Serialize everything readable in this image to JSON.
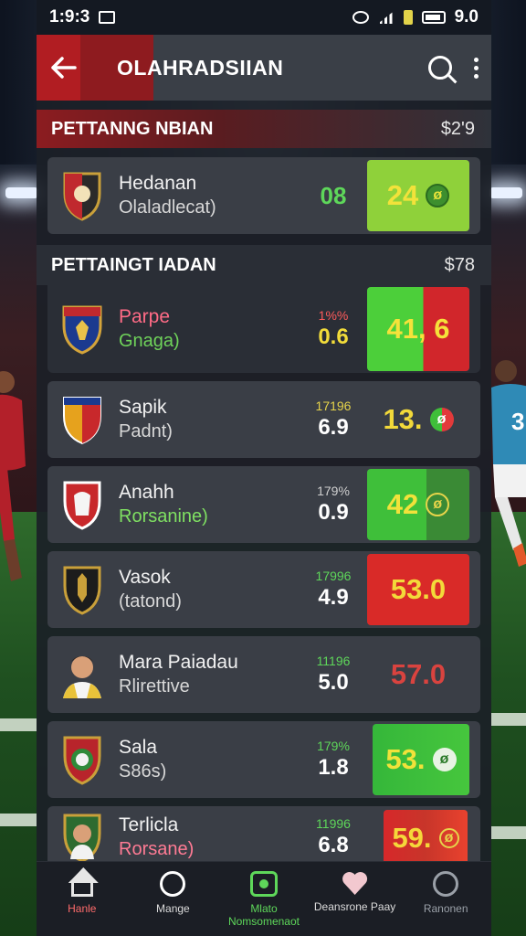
{
  "status": {
    "time": "1:9:3",
    "right_text": "9.0"
  },
  "appbar": {
    "title": "OLAHRADSIIAN",
    "icons": [
      "back-arrow-icon",
      "search-icon",
      "more-vert-icon"
    ]
  },
  "sections": [
    {
      "title": "PETTANNG NBIAN",
      "amount": "$2'9"
    },
    {
      "title": "PETTAINGT IADAN",
      "amount": "$78"
    }
  ],
  "cards": [
    {
      "name": "Hedanan",
      "sub": "Olaladlecat)",
      "pct": "",
      "odds": "08",
      "score": "24",
      "badge": "ø",
      "crest": "#c0292e"
    },
    {
      "name": "Parpe",
      "sub": "Gnaga)",
      "pct": "1%%",
      "odds": "0.6",
      "score": "41, 6",
      "badge": "",
      "crest": "#1b3a8f"
    },
    {
      "name": "Sapik",
      "sub": "Padnt)",
      "pct": "17196",
      "odds": "6.9",
      "score": "13.",
      "badge": "ø",
      "crest": "#e6a21d"
    },
    {
      "name": "Anahh",
      "sub": "Rorsanine)",
      "pct": "179%",
      "odds": "0.9",
      "score": "42",
      "badge": "ø",
      "crest": "#c8282b"
    },
    {
      "name": "Vasok",
      "sub": "(tatond)",
      "pct": "17996",
      "odds": "4.9",
      "score": "53.0",
      "badge": "",
      "crest": "#1c1c1c"
    },
    {
      "name": "Mara Paiadau",
      "sub": "Rlirettive",
      "pct": "11196",
      "odds": "5.0",
      "score": "57.0",
      "badge": "",
      "crest": "#d9a04a"
    },
    {
      "name": "Sala",
      "sub": "S86s)",
      "pct": "179%",
      "odds": "1.8",
      "score": "53.",
      "badge": "ø",
      "crest": "#b8242b"
    },
    {
      "name": "Terlicla",
      "sub": "Rorsane)",
      "pct": "11996",
      "odds": "6.8",
      "score": "59.",
      "badge": "ø",
      "crest": "#2d6b30"
    }
  ],
  "nav": [
    {
      "label": "Hanle",
      "icon": "home-icon"
    },
    {
      "label": "Mange",
      "icon": "match-icon"
    },
    {
      "label": "Mlato Nomsomenaot",
      "icon": "live-icon"
    },
    {
      "label": "Deansrone Paay",
      "icon": "heart-icon"
    },
    {
      "label": "Ranonen",
      "icon": "circle-icon"
    }
  ]
}
